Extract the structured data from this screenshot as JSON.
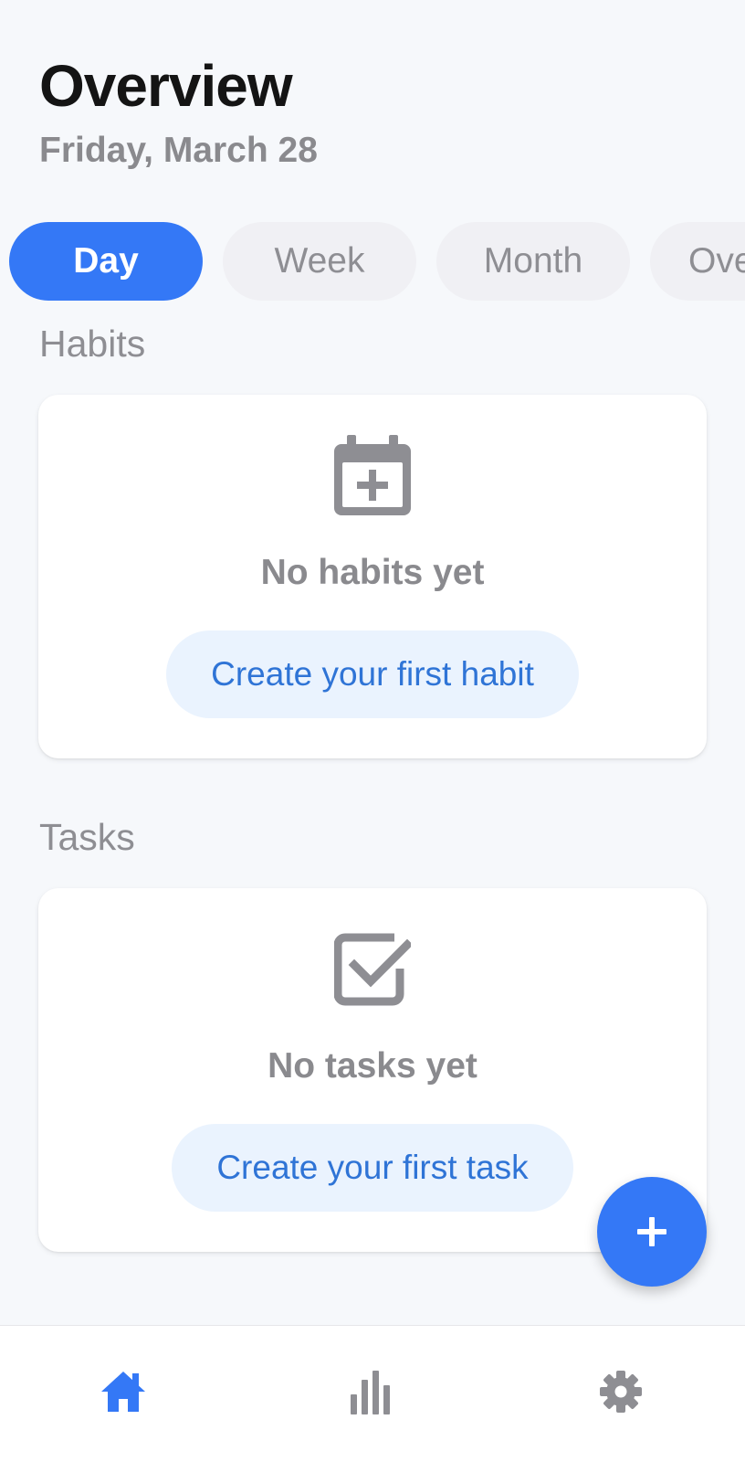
{
  "header": {
    "title": "Overview",
    "date": "Friday, March 28"
  },
  "tabs": [
    {
      "label": "Day",
      "active": true
    },
    {
      "label": "Week",
      "active": false
    },
    {
      "label": "Month",
      "active": false
    },
    {
      "label": "Ove",
      "active": false
    }
  ],
  "habits": {
    "section_label": "Habits",
    "icon": "calendar-plus-icon",
    "empty_text": "No habits yet",
    "cta_label": "Create your first habit"
  },
  "tasks": {
    "section_label": "Tasks",
    "icon": "checkbox-checked-icon",
    "empty_text": "No tasks yet",
    "cta_label": "Create your first task"
  },
  "fab": {
    "icon": "plus-icon"
  },
  "bottom_nav": [
    {
      "icon": "home-icon",
      "active": true
    },
    {
      "icon": "bar-chart-icon",
      "active": false
    },
    {
      "icon": "gear-icon",
      "active": false
    }
  ],
  "colors": {
    "accent": "#3478f6",
    "background": "#f6f8fb",
    "muted_text": "#8e8e93",
    "cta_background": "#eaf3fe",
    "cta_text": "#2f74d6"
  }
}
